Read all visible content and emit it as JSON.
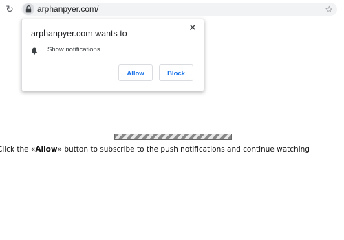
{
  "browser": {
    "url": "arphanpyer.com/",
    "icons": {
      "reload": "reload-icon",
      "lock": "lock-icon",
      "bookmark": "star-icon"
    }
  },
  "popup": {
    "title": "arphanpyer.com wants to",
    "permission_label": "Show notifications",
    "allow_label": "Allow",
    "block_label": "Block",
    "icons": {
      "close": "close-icon",
      "permission": "bell-icon"
    },
    "accent_color": "#1a73e8"
  },
  "progress": {
    "value": 1.0
  },
  "message": {
    "prefix": "Click the «",
    "highlight": "Allow",
    "suffix": "» button to subscribe to the push notifications and continue watching"
  }
}
